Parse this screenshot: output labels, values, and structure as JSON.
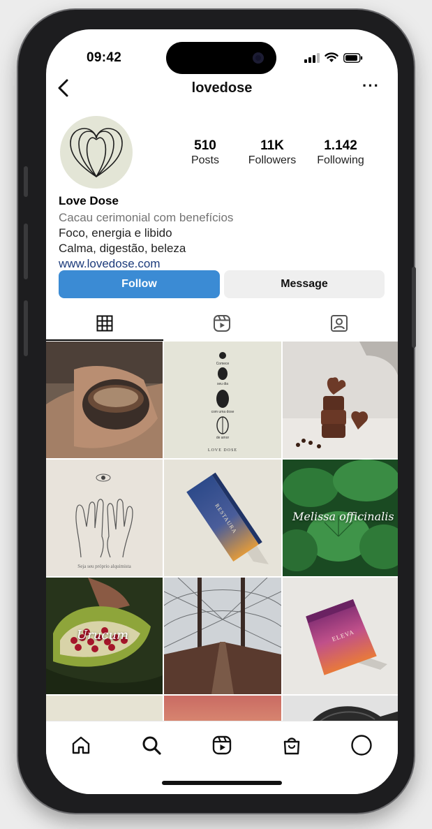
{
  "status": {
    "time": "09:42"
  },
  "header": {
    "username": "lovedose",
    "more": "···"
  },
  "profile": {
    "stats": [
      {
        "value": "510",
        "label": "Posts"
      },
      {
        "value": "11K",
        "label": "Followers"
      },
      {
        "value": "1.142",
        "label": "Following"
      }
    ],
    "name": "Love Dose",
    "category": "Cacau cerimonial com benefícios",
    "bio_lines": [
      "Foco, energia e libido",
      "Calma, digestão, beleza"
    ],
    "website": "www.lovedose.com"
  },
  "actions": {
    "follow_label": "Follow",
    "message_label": "Message"
  },
  "tabs": [
    {
      "icon": "grid-icon",
      "active": true
    },
    {
      "icon": "reels-icon",
      "active": false
    },
    {
      "icon": "tagged-icon",
      "active": false
    }
  ],
  "posts": {
    "post2_lines": [
      "Comece",
      "seu dia",
      "com uma dose",
      "de amor",
      "LOVE DOSE"
    ],
    "post4_caption": "Seja seu próprio alquimista",
    "post5_label": "RESTAURA",
    "post6_caption": "Melissa officinalis",
    "post7_caption": "Urucum",
    "post9_label": "ELEVA"
  },
  "bottom_nav": [
    "home-icon",
    "search-icon",
    "reels-icon",
    "shop-icon",
    "profile-icon"
  ],
  "colors": {
    "follow": "#3b8bd4",
    "message": "#efefef",
    "avatar_bg": "#e3e5d6",
    "link": "#1b3a7a"
  }
}
